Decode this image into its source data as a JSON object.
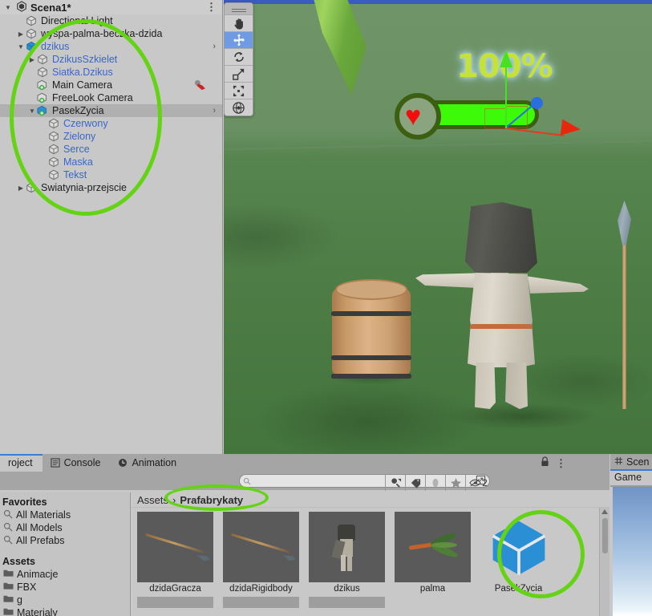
{
  "hierarchy": {
    "scene_name": "Scena1*",
    "menu_icon": "kebab-menu-icon",
    "rows": [
      {
        "label": "Directional Light",
        "indent": 1,
        "icon": "gameobject-cube-icon",
        "twisty": "none",
        "prefab": false,
        "selected": false,
        "chevron": false
      },
      {
        "label": "wyspa-palma-beczka-dzida",
        "indent": 1,
        "icon": "gameobject-cube-icon",
        "twisty": "right",
        "prefab": false,
        "selected": false,
        "chevron": false
      },
      {
        "label": "dzikus",
        "indent": 1,
        "icon": "prefab-cube-icon",
        "twisty": "down",
        "prefab": true,
        "selected": false,
        "chevron": true
      },
      {
        "label": "DzikusSzkielet",
        "indent": 2,
        "icon": "gameobject-cube-icon",
        "twisty": "right",
        "prefab": true,
        "selected": false,
        "chevron": false
      },
      {
        "label": "Siatka.Dzikus",
        "indent": 2,
        "icon": "gameobject-cube-icon",
        "twisty": "none",
        "prefab": true,
        "selected": false,
        "chevron": false
      },
      {
        "label": "Main Camera",
        "indent": 2,
        "icon": "gameobject-plus-icon",
        "twisty": "none",
        "prefab": false,
        "selected": false,
        "chevron": false,
        "badge": "script-red-icon"
      },
      {
        "label": "FreeLook Camera",
        "indent": 2,
        "icon": "gameobject-plus-icon",
        "twisty": "none",
        "prefab": false,
        "selected": false,
        "chevron": false
      },
      {
        "label": "PasekZycia",
        "indent": 2,
        "icon": "prefab-plus-cube-icon",
        "twisty": "down",
        "prefab": false,
        "selected": true,
        "chevron": true
      },
      {
        "label": "Czerwony",
        "indent": 3,
        "icon": "gameobject-cube-icon",
        "twisty": "none",
        "prefab": true,
        "selected": false,
        "chevron": false
      },
      {
        "label": "Zielony",
        "indent": 3,
        "icon": "gameobject-cube-icon",
        "twisty": "none",
        "prefab": true,
        "selected": false,
        "chevron": false
      },
      {
        "label": "Serce",
        "indent": 3,
        "icon": "gameobject-cube-icon",
        "twisty": "none",
        "prefab": true,
        "selected": false,
        "chevron": false
      },
      {
        "label": "Maska",
        "indent": 3,
        "icon": "gameobject-cube-icon",
        "twisty": "none",
        "prefab": true,
        "selected": false,
        "chevron": false
      },
      {
        "label": "Tekst",
        "indent": 3,
        "icon": "gameobject-cube-icon",
        "twisty": "none",
        "prefab": true,
        "selected": false,
        "chevron": false
      },
      {
        "label": "Swiatynia-przejscie",
        "indent": 1,
        "icon": "gameobject-cube-icon",
        "twisty": "right",
        "prefab": false,
        "selected": false,
        "chevron": false
      }
    ]
  },
  "scene_view": {
    "tools": [
      {
        "name": "hand-tool",
        "active": false
      },
      {
        "name": "move-tool",
        "active": true
      },
      {
        "name": "rotate-tool",
        "active": false
      },
      {
        "name": "scale-tool",
        "active": false
      },
      {
        "name": "rect-tool",
        "active": false
      },
      {
        "name": "transform-tool",
        "active": false
      }
    ],
    "overlay": {
      "health_percent_label": "100%",
      "health_fill_color": "#3dfb08",
      "health_border_color": "#3c5f12",
      "heart_color": "#f40d0d",
      "percent_text_color": "#c6e23a"
    },
    "objects": [
      {
        "name": "palm-leaf"
      },
      {
        "name": "barrel"
      },
      {
        "name": "character-dzikus"
      },
      {
        "name": "spear-dzida"
      }
    ]
  },
  "project_panel": {
    "tabs": [
      {
        "label": "roject",
        "icon": "",
        "active": true
      },
      {
        "label": "Console",
        "icon": "console-icon",
        "active": false
      },
      {
        "label": "Animation",
        "icon": "clock-icon",
        "active": false
      }
    ],
    "lock_icon": "lock-icon",
    "menu_icon": "kebab-menu-icon",
    "search": {
      "value": "",
      "placeholder": "",
      "icon": "search-icon"
    },
    "toolbar_buttons": [
      {
        "name": "save-search-icon"
      },
      {
        "name": "label-tag-icon"
      },
      {
        "name": "type-filter-icon"
      },
      {
        "name": "favorite-star-icon"
      }
    ],
    "hidden_items": {
      "icon": "hidden-eye-icon",
      "count": "2"
    },
    "tree": {
      "favorites_header": "Favorites",
      "favorites": [
        {
          "label": "All Materials",
          "icon": "search-icon"
        },
        {
          "label": "All Models",
          "icon": "search-icon"
        },
        {
          "label": "All Prefabs",
          "icon": "search-icon"
        }
      ],
      "assets_header": "Assets",
      "folders": [
        {
          "label": "Animacje",
          "icon": "folder-icon"
        },
        {
          "label": "FBX",
          "icon": "folder-icon"
        },
        {
          "label": "g",
          "icon": "folder-icon"
        },
        {
          "label": "Materialy",
          "icon": "folder-icon"
        }
      ]
    },
    "breadcrumb": {
      "root": "Assets",
      "separator": "›",
      "current": "Prafabrykaty"
    },
    "assets": [
      {
        "name": "dzidaGracza",
        "thumb": "spear",
        "selected": false
      },
      {
        "name": "dzidaRigidbody",
        "thumb": "spear",
        "selected": false
      },
      {
        "name": "dzikus",
        "thumb": "character",
        "selected": false
      },
      {
        "name": "palma",
        "thumb": "palm",
        "selected": false
      },
      {
        "name": "PasekZycia",
        "thumb": "prefab-cube",
        "selected": true
      }
    ],
    "scrollbar": {
      "name": "vertical-scrollbar"
    }
  },
  "game_panel": {
    "scene_tab": {
      "label": "Scen",
      "icon": "grid-hash-icon"
    },
    "game_tab": {
      "label": "Game"
    }
  },
  "annotations": {
    "color": "#63d314",
    "circles": [
      {
        "name": "hierarchy-highlight"
      },
      {
        "name": "prafabrykaty-breadcrumb-highlight"
      },
      {
        "name": "pasekzycia-asset-highlight"
      }
    ]
  }
}
